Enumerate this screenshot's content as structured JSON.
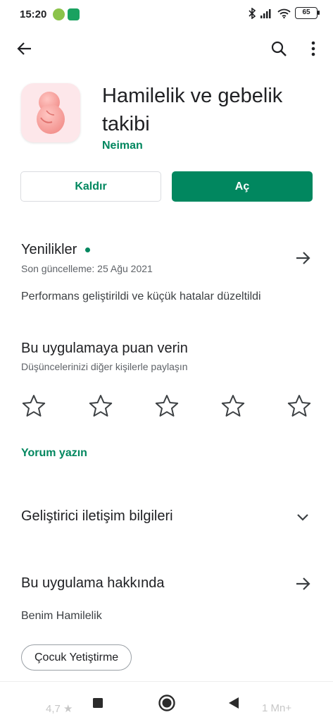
{
  "status_bar": {
    "time": "15:20",
    "battery": "65"
  },
  "top_bar": {
    "back_icon": "arrow-left-icon",
    "search_icon": "search-icon",
    "more_icon": "more-vert-icon"
  },
  "app": {
    "title": "Hamilelik ve gebelik takibi",
    "developer": "Neiman",
    "icon": "fetus-icon",
    "icon_background": "#fde7ea"
  },
  "buttons": {
    "uninstall": "Kaldır",
    "open": "Aç"
  },
  "whats_new": {
    "title": "Yenilikler",
    "date": "Son güncelleme: 25 Ağu 2021",
    "body": "Performans geliştirildi ve küçük hatalar düzeltildi"
  },
  "rate": {
    "title": "Bu uygulamaya puan verin",
    "subtitle": "Düşüncelerinizi diğer kişilerle paylaşın",
    "stars_count": 5,
    "write_review": "Yorum yazın"
  },
  "developer_contact": {
    "title": "Geliştirici iletişim bilgileri"
  },
  "about": {
    "title": "Bu uygulama hakkında",
    "body": "Benim Hamilelik",
    "chip": "Çocuk Yetiştirme"
  },
  "bottom_peek": {
    "left": "4,7 ★",
    "right": "1 Mn+"
  },
  "colors": {
    "accent": "#01875f",
    "text": "#202124",
    "secondary": "#5f6368"
  }
}
